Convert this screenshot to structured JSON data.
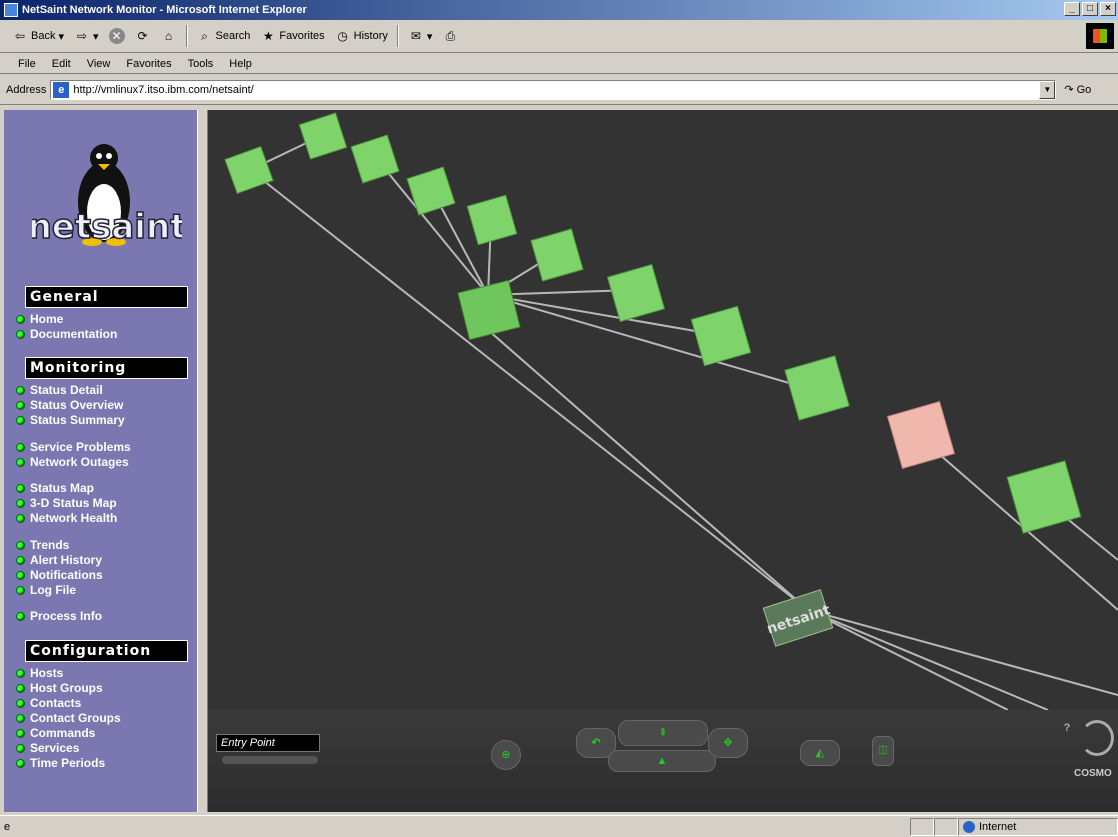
{
  "window": {
    "title": "NetSaint Network Monitor - Microsoft Internet Explorer"
  },
  "toolbar": {
    "back": "Back",
    "search": "Search",
    "favorites": "Favorites",
    "history": "History"
  },
  "menu": [
    "File",
    "Edit",
    "View",
    "Favorites",
    "Tools",
    "Help"
  ],
  "address": {
    "label": "Address",
    "url": "http://vmlinux7.itso.ibm.com/netsaint/",
    "go": "Go"
  },
  "sidebar": {
    "logo_text": "netsaint",
    "general": {
      "title": "General",
      "items": [
        "Home",
        "Documentation"
      ]
    },
    "monitoring": {
      "title": "Monitoring",
      "items": [
        "Status Detail",
        "Status Overview",
        "Status Summary",
        "Service Problems",
        "Network Outages",
        "Status Map",
        "3-D Status Map",
        "Network Health",
        "Trends",
        "Alert History",
        "Notifications",
        "Log File",
        "Process Info"
      ]
    },
    "configuration": {
      "title": "Configuration",
      "items": [
        "Hosts",
        "Host Groups",
        "Contacts",
        "Contact Groups",
        "Commands",
        "Services",
        "Time Periods"
      ]
    }
  },
  "viewer": {
    "entry_point": "Entry Point",
    "cosmo_label": "COSMO",
    "root_label": "netsaint",
    "colors": {
      "background": "#333333",
      "up": "#7fd36b",
      "down": "#f0b7ad",
      "line": "#b8b8b8"
    }
  },
  "status": {
    "zone": "Internet"
  }
}
